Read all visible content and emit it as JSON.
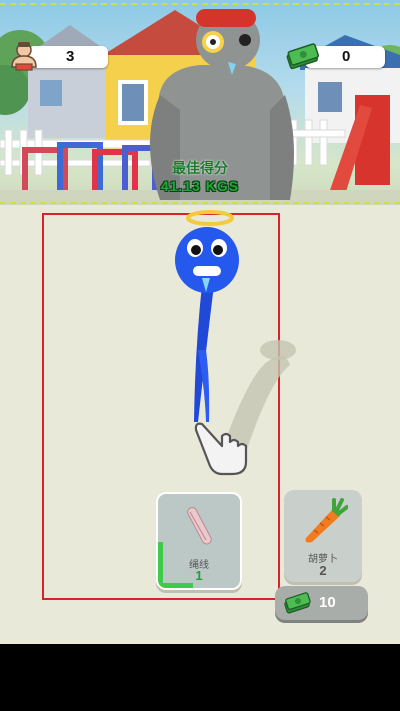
{
  "hud": {
    "character_count": "3",
    "cash": "0",
    "best_score_label": "最佳得分",
    "best_score_value": "41.13 KGS"
  },
  "items": [
    {
      "name": "绳线",
      "count": "1",
      "icon": "rope-icon",
      "progress": 0.25
    },
    {
      "name": "胡萝卜",
      "count": "2",
      "icon": "carrot-icon"
    }
  ],
  "buy": {
    "price": "10",
    "icon": "cash-icon"
  },
  "colors": {
    "accent_green": "#1faa38",
    "frame_red": "#d8232a",
    "dash_yellow": "#c7e24a"
  }
}
